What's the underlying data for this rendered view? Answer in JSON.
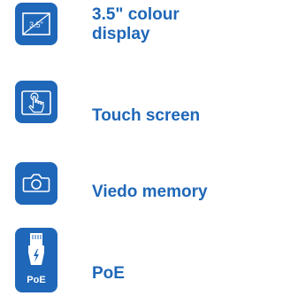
{
  "features": [
    {
      "icon": "display-size-icon",
      "label_line1": "3.5\" colour",
      "label_line2": "display",
      "icon_text": "3.5\""
    },
    {
      "icon": "touch-hand-icon",
      "label": "Touch screen"
    },
    {
      "icon": "camera-icon",
      "label": "Viedo memory"
    },
    {
      "icon": "poe-plug-icon",
      "label": "PoE",
      "icon_text": "PoE"
    }
  ],
  "colors": {
    "accent": "#1f67b8",
    "background": "#ffffff"
  }
}
